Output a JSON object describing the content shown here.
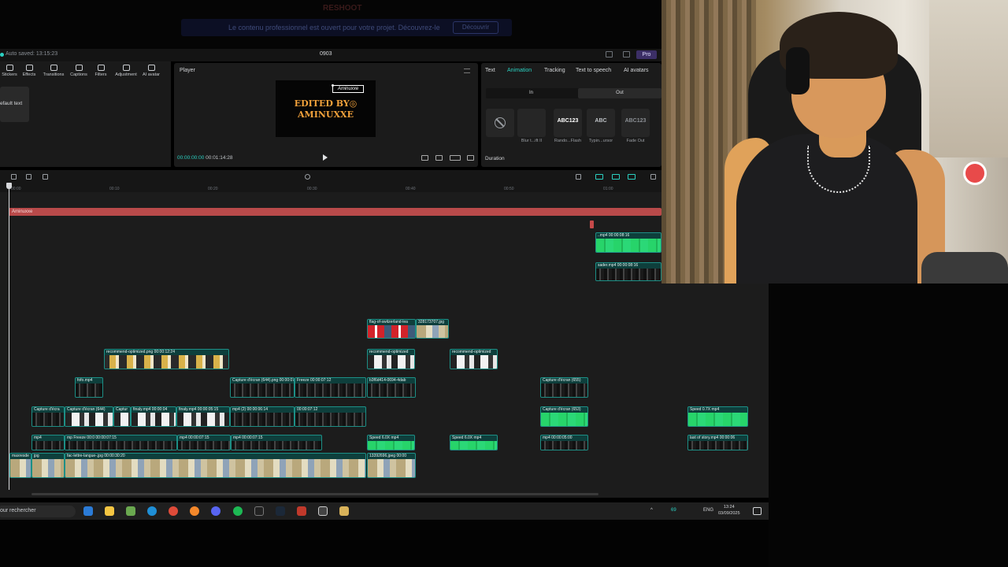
{
  "topbar": {
    "brand": "RESHOOT",
    "promo_text": "Le contenu professionnel est ouvert pour votre projet. Découvrez-le",
    "promo_button": "Découvrir"
  },
  "titlebar": {
    "autosave": "Auto saved: 13:15:23",
    "project": "0903",
    "pro": "Pro"
  },
  "tools": [
    "Stickers",
    "Effects",
    "Transitions",
    "Captions",
    "Filters",
    "Adjustment",
    "AI avatar"
  ],
  "leftpanel": {
    "default_text": "efault text"
  },
  "player": {
    "title": "Player",
    "watermark": "Aminuxxe",
    "line1": "EDITED BY◎",
    "line2": "AMINUXXE",
    "current_time": "00:00:00:00",
    "duration": "00:01:14:28"
  },
  "inspector": {
    "tabs": [
      "Text",
      "Animation",
      "Tracking",
      "Text to speech",
      "AI avatars"
    ],
    "active_tab": "Animation",
    "in_label": "In",
    "out_label": "Out",
    "animations": [
      {
        "thumb": "",
        "label": ""
      },
      {
        "thumb": "",
        "label": "Blur t...ift II"
      },
      {
        "thumb": "ABC123",
        "label": "Rando...Flash"
      },
      {
        "thumb": "ABC",
        "label": "Typin...ursor"
      },
      {
        "thumb": "ABC123",
        "label": "Fade Out"
      }
    ],
    "duration_label": "Duration"
  },
  "ruler": [
    "00:00",
    "00:10",
    "00:20",
    "00:30",
    "00:40",
    "00:50",
    "01:00"
  ],
  "timeline": {
    "text_track": "Aminuxxe",
    "clips": [
      {
        "label": "..mp4  00:00:08:16",
        "style": "green"
      },
      {
        "label": "sader.mp4  00:00:08:16",
        "style": "dark"
      },
      {
        "label": "flag-of-switzerland-lea",
        "style": "swiss"
      },
      {
        "label": "328173707.jpg",
        "style": "land"
      },
      {
        "label": "recommend-optimized.png  00:00:12:24",
        "style": "yellow"
      },
      {
        "label": "recommend-optimized",
        "style": "white"
      },
      {
        "label": "recommend-optimized",
        "style": "white"
      },
      {
        "label": "fofo.mp4",
        "style": "dark"
      },
      {
        "label": "Capture d'écran (644).png  00:00:07:12",
        "style": "dark"
      },
      {
        "label": "Freeze  00:00:07:12",
        "style": "dark"
      },
      {
        "label": "b3f6d414-0694-4dab",
        "style": "dark"
      },
      {
        "label": "Capture d'écran (655)",
        "style": "dark"
      },
      {
        "label": "Capture d'écra",
        "style": "dark"
      },
      {
        "label": "Capture d'écran (644)",
        "style": "white"
      },
      {
        "label": "Captur",
        "style": "white"
      },
      {
        "label": "finaly.mp4  00:00:04",
        "style": "white"
      },
      {
        "label": "finaly.mp4  00:00:05:15",
        "style": "white"
      },
      {
        "label": "mp4 (2)  00:00:06:14",
        "style": "dark"
      },
      {
        "label": "00:00:07:12",
        "style": "dark"
      },
      {
        "label": "Capture d'écran (653)",
        "style": "green"
      },
      {
        "label": "Speed 0.7X  mp4",
        "style": "green"
      },
      {
        "label": "mp4",
        "style": "dark"
      },
      {
        "label": "mp  Freeze  00:0  00:00:07:15",
        "style": "dark"
      },
      {
        "label": "mp4  00:00:07:15",
        "style": "dark"
      },
      {
        "label": "mp4  00:00:07:15",
        "style": "dark"
      },
      {
        "label": "Speed 6.0X  mp4",
        "style": "green"
      },
      {
        "label": "Speed 6.0X  mp4",
        "style": "green"
      },
      {
        "label": "mp4  00:00:05:00",
        "style": "dark"
      },
      {
        "label": "last of story.mp4  00:00:06",
        "style": "dark"
      },
      {
        "label": "maxresde",
        "style": "land"
      },
      {
        "label": "jpg",
        "style": "land"
      },
      {
        "label": "fac-lettre-langue-.jpg  00:00:30:20",
        "style": "land"
      },
      {
        "label": "13392696.jpeg  00:00",
        "style": "land"
      }
    ]
  },
  "taskbar": {
    "search_placeholder": "our rechercher",
    "lang": "ENG",
    "badge": "69",
    "time": "13:24",
    "date": "03/09/2025"
  },
  "colors": {
    "accent": "#2bd1c2",
    "text_track": "#b94a4a",
    "clip_border": "#1d8f86",
    "clip_bg": "#0e3f3c"
  }
}
